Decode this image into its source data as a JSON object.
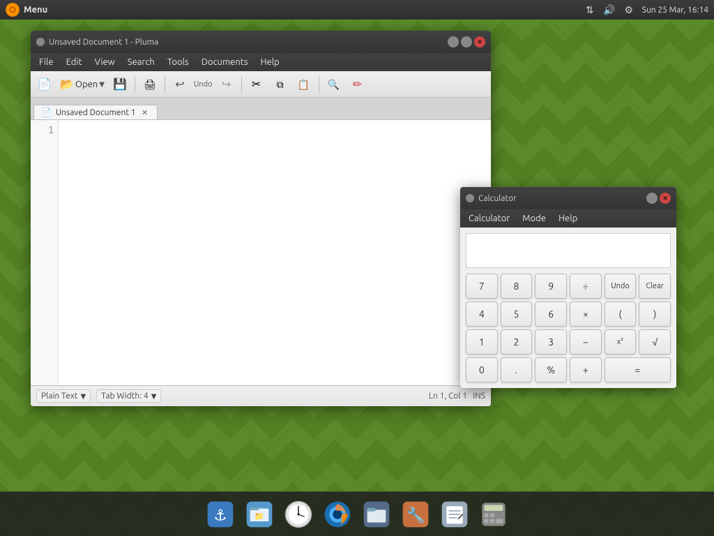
{
  "desktop": {
    "bg_color": "#5a8a2a"
  },
  "top_panel": {
    "menu_label": "Menu",
    "datetime": "Sun 25 Mar, 16:14"
  },
  "pluma": {
    "title": "Unsaved Document 1 - Pluma",
    "tab_label": "Unsaved Document 1",
    "menus": [
      "File",
      "Edit",
      "View",
      "Search",
      "Tools",
      "Documents",
      "Help"
    ],
    "toolbar": {
      "open_label": "Open",
      "save_label": "Save",
      "undo_label": "Undo"
    },
    "line_numbers": [
      "1"
    ],
    "status": {
      "plain_text": "Plain Text",
      "tab_width": "Tab Width:  4",
      "cursor": "Ln 1, Col 1",
      "mode": "INS"
    }
  },
  "calculator": {
    "title": "Calculator",
    "menus": [
      "Calculator",
      "Mode",
      "Help"
    ],
    "display_value": "",
    "buttons": [
      {
        "label": "7",
        "col": 1
      },
      {
        "label": "8",
        "col": 1
      },
      {
        "label": "9",
        "col": 1
      },
      {
        "label": "÷",
        "col": 1
      },
      {
        "label": "Undo",
        "col": 1
      },
      {
        "label": "4",
        "col": 1
      },
      {
        "label": "5",
        "col": 1
      },
      {
        "label": "6",
        "col": 1
      },
      {
        "label": "×",
        "col": 1
      },
      {
        "label": "(",
        "col": 1
      },
      {
        "label": ")",
        "col": 1
      },
      {
        "label": "1",
        "col": 1
      },
      {
        "label": "2",
        "col": 1
      },
      {
        "label": "3",
        "col": 1
      },
      {
        "label": "−",
        "col": 1
      },
      {
        "label": "x²",
        "col": 1
      },
      {
        "label": "√",
        "col": 1
      },
      {
        "label": "0",
        "col": 1
      },
      {
        "label": ".",
        "col": 1
      },
      {
        "label": "%",
        "col": 1
      },
      {
        "label": "+",
        "col": 1
      },
      {
        "label": "=",
        "col": 1
      }
    ],
    "clear_label": "Clear"
  },
  "taskbar": {
    "icons": [
      {
        "name": "wharfmaster",
        "label": "Wharfmaster",
        "color": "#3a7abf"
      },
      {
        "name": "file-manager",
        "label": "File Manager",
        "color": "#5599cc"
      },
      {
        "name": "clock",
        "label": "Clock",
        "color": "#888"
      },
      {
        "name": "firefox",
        "label": "Firefox",
        "color": "#e84"
      },
      {
        "name": "thunar",
        "label": "Thunar",
        "color": "#7ba"
      },
      {
        "name": "system-tools",
        "label": "System Tools",
        "color": "#c87"
      },
      {
        "name": "text-editor",
        "label": "Text Editor",
        "color": "#9ab"
      },
      {
        "name": "calculator-dock",
        "label": "Calculator",
        "color": "#999"
      }
    ]
  }
}
